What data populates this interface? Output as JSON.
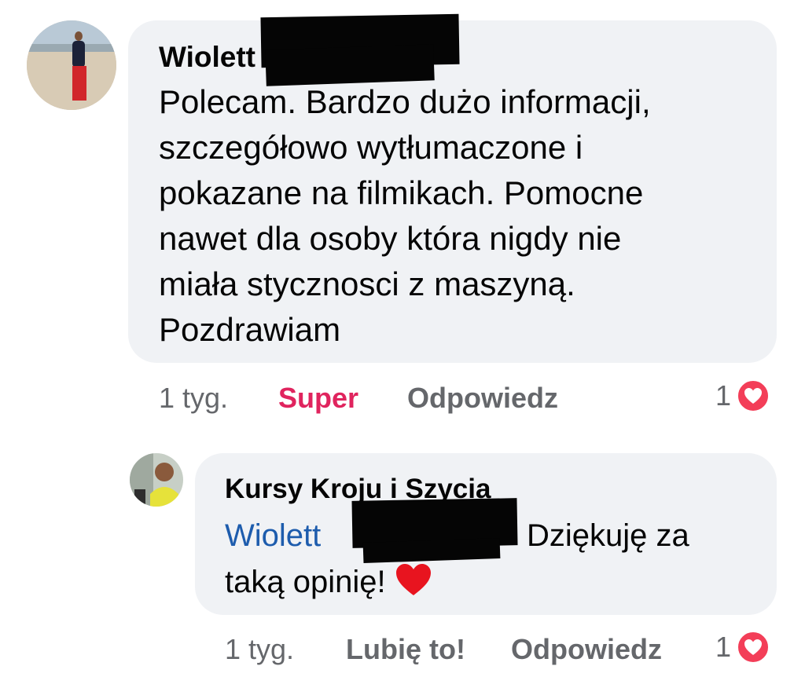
{
  "comment": {
    "author_visible": "Wiolett",
    "text_lines": [
      "Polecam. Bardzo dużo informacji,",
      "szczegółowo wytłumaczone i",
      "pokazane na filmikach. Pomocne",
      "nawet dla osoby która nigdy nie",
      "miała stycznosci z maszyną.",
      "Pozdrawiam"
    ],
    "time": "1 tyg.",
    "reaction_label": "Super",
    "reply_label": "Odpowiedz",
    "reaction_count": "1"
  },
  "reply": {
    "author": "Kursy Kroju i Szycia",
    "mention_visible": "Wiolett",
    "text_after_mention": "Dziękuję za",
    "text_line2": "taką opinię!",
    "time": "1 tyg.",
    "like_label": "Lubię to!",
    "reply_label": "Odpowiedz",
    "reaction_count": "1"
  },
  "colors": {
    "bubble": "#f0f2f5",
    "love_reaction": "#f33e58",
    "mention": "#1d5cad",
    "meta": "#65676b"
  },
  "icons": [
    "love-reaction-icon",
    "red-heart-emoji"
  ]
}
